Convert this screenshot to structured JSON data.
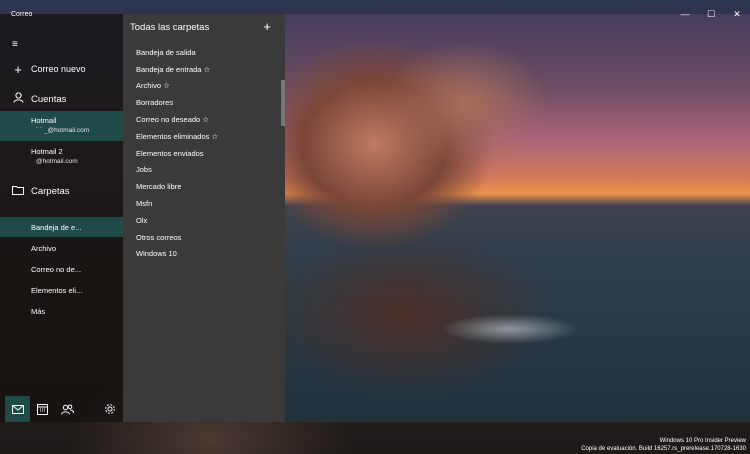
{
  "app": {
    "title": "Correo",
    "controls": {
      "minimize": "—",
      "maximize": "☐",
      "close": "✕"
    }
  },
  "nav": {
    "menu_icon": "≡",
    "new_mail": {
      "icon": "+",
      "label": "Correo nuevo"
    },
    "accounts_header": {
      "icon": "person-icon",
      "label": "Cuentas"
    },
    "accounts": [
      {
        "name": "Hotmail",
        "email": "` `  _@hotmail.com",
        "selected": true
      },
      {
        "name": "Hotmail 2",
        "email": "@hotmail.com",
        "selected": false
      }
    ],
    "folders_header": {
      "icon": "folder-icon",
      "label": "Carpetas"
    },
    "folders": [
      {
        "label": "Bandeja de e...",
        "selected": true
      },
      {
        "label": "Archivo",
        "selected": false
      },
      {
        "label": "Correo no de...",
        "selected": false
      },
      {
        "label": "Elementos eli...",
        "selected": false
      },
      {
        "label": "Más",
        "selected": false
      }
    ],
    "bottom_buttons": [
      "mail-icon",
      "calendar-icon",
      "people-icon",
      "settings-icon"
    ]
  },
  "flyout": {
    "title": "Todas las carpetas",
    "add_icon": "+",
    "items": [
      "Bandeja de salida",
      "Bandeja de entrada ☆",
      "Archivo ☆",
      "Borradores",
      "Correo no deseado ☆",
      "Elementos eliminados ☆",
      "Elementos enviados",
      "Jobs",
      "Mercado libre",
      "Msfn",
      "Olx",
      "Otros correos",
      "Windows 10"
    ]
  },
  "watermark": {
    "line1": "Windows 10 Pro Insider Preview",
    "line2": "Copia de evaluación. Build 16257.rs_prerelease.170728-1630"
  },
  "colors": {
    "accent": "#1f4a48",
    "flyout_bg": "#3a3a3a"
  }
}
